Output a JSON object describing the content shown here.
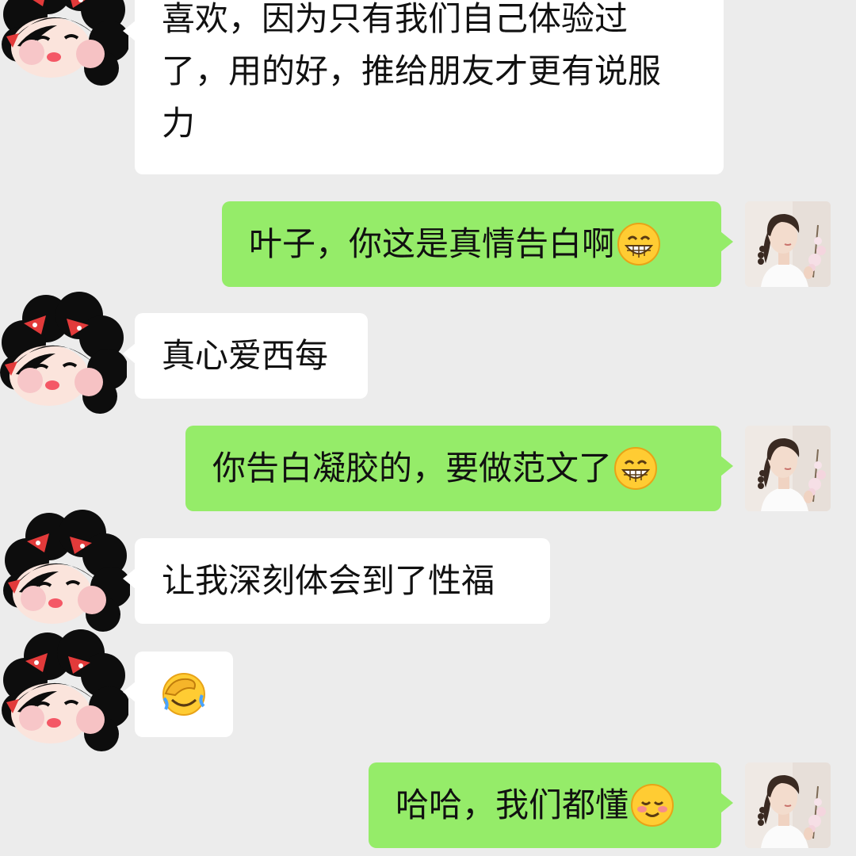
{
  "chat": {
    "messages": [
      {
        "side": "in",
        "lines": [
          "喜欢，因为只有我们自己体验过",
          "了，用的好，推给朋友才更有说服",
          "力"
        ]
      },
      {
        "side": "out",
        "text": "叶子，你这是真情告白啊",
        "emoji": "grinning-face-icon"
      },
      {
        "side": "in",
        "text": "真心爱西每"
      },
      {
        "side": "out",
        "text": "你告白凝胶的，要做范文了",
        "emoji": "grinning-face-icon"
      },
      {
        "side": "in",
        "text": "让我深刻体会到了性福"
      },
      {
        "side": "in",
        "emoji": "facepalm-icon"
      },
      {
        "side": "out",
        "text": "哈哈，我们都懂",
        "emoji": "blushing-face-icon"
      }
    ]
  },
  "colors": {
    "background": "#ececec",
    "incoming_bubble": "#ffffff",
    "outgoing_bubble": "#95ec69",
    "text": "#111111"
  }
}
